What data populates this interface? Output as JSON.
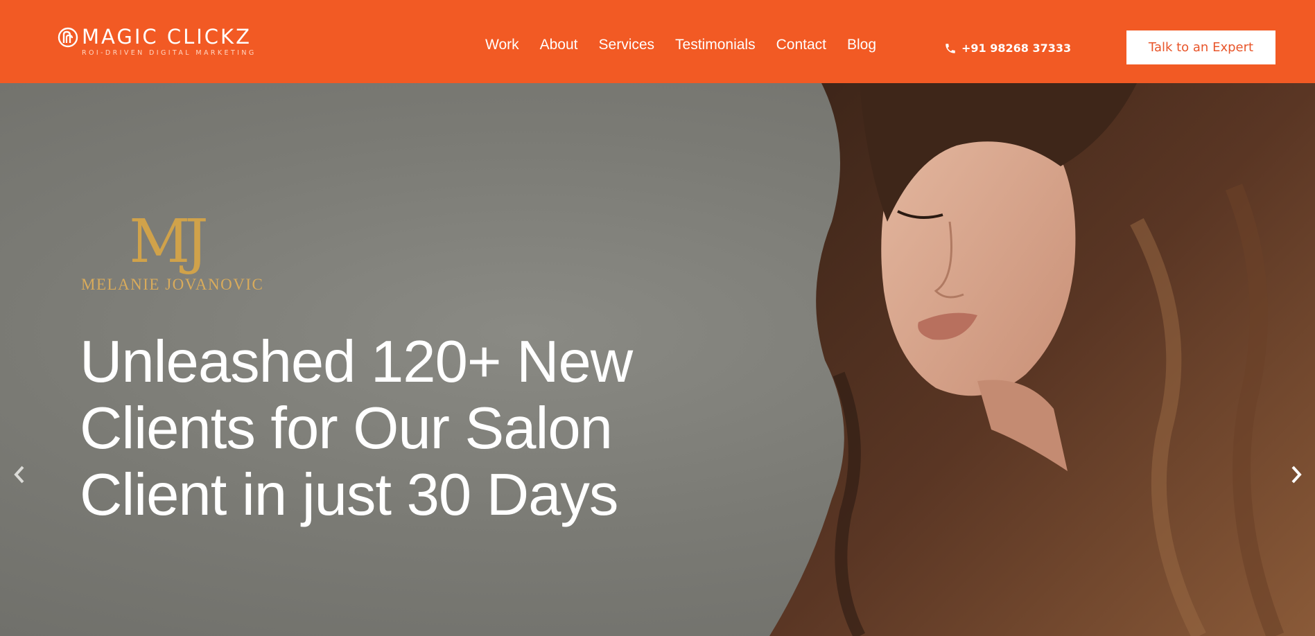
{
  "header": {
    "logo_name": "MAGIC CLICKZ",
    "logo_tagline": "ROI-DRIVEN DIGITAL MARKETING",
    "nav": [
      {
        "label": "Work"
      },
      {
        "label": "About"
      },
      {
        "label": "Services"
      },
      {
        "label": "Testimonials"
      },
      {
        "label": "Contact"
      },
      {
        "label": "Blog"
      }
    ],
    "phone": "+91 98268 37333",
    "phone_icon": "phone-icon",
    "cta_label": "Talk to an Expert"
  },
  "hero": {
    "brand_initials": "MJ",
    "brand_name": "MELANIE JOVANOVIC",
    "headline_lines": [
      "Unleashed 120+ New",
      "Clients for Our Salon",
      "Client in just 30 Days"
    ],
    "prev_icon": "chevron-left-icon",
    "next_icon": "chevron-right-icon"
  },
  "colors": {
    "brand_orange": "#f25a24",
    "gold": "#d0a24a",
    "hero_gray": "#7c7c76",
    "white": "#ffffff"
  }
}
